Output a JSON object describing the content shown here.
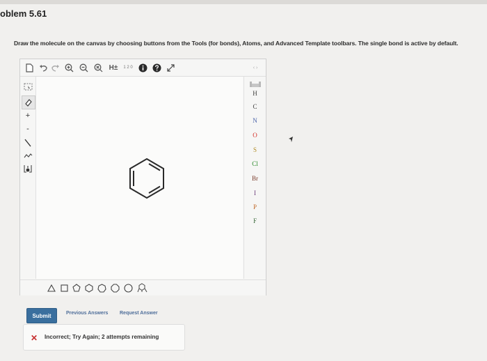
{
  "problem": {
    "title": "oblem 5.61"
  },
  "instructions": "Draw the molecule on the canvas by choosing buttons from the Tools (for bonds), Atoms, and Advanced Template toolbars. The single bond is active by default.",
  "editor": {
    "top_toolbar": {
      "icons": [
        "new-document-icon",
        "undo-icon",
        "redo-icon",
        "zoom-in-icon",
        "zoom-out-icon",
        "zoom-fit-icon",
        "hydrogen-toggle-icon",
        "numbering-icon",
        "info-icon",
        "help-icon",
        "fullscreen-icon"
      ],
      "hydrogen_label": "H±",
      "numbering_label": "1 2 0",
      "expand_label": "‹ ›"
    },
    "left_toolbar": {
      "icons": [
        "select-icon",
        "eraser-icon",
        "charge-plus-icon",
        "charge-minus-icon",
        "single-bond-icon",
        "chain-icon",
        "template-icon"
      ],
      "plus_label": "+",
      "minus_label": "-"
    },
    "atoms": [
      {
        "symbol": "H",
        "color": "#3b3b3b"
      },
      {
        "symbol": "C",
        "color": "#3b3b3b"
      },
      {
        "symbol": "N",
        "color": "#4a62a8"
      },
      {
        "symbol": "O",
        "color": "#d4302a"
      },
      {
        "symbol": "S",
        "color": "#b08a22"
      },
      {
        "symbol": "Cl",
        "color": "#2a8a2a"
      },
      {
        "symbol": "Br",
        "color": "#7a3b2b"
      },
      {
        "symbol": "I",
        "color": "#6b3b7a"
      },
      {
        "symbol": "P",
        "color": "#c06a2a"
      },
      {
        "symbol": "F",
        "color": "#3b6a3b"
      }
    ],
    "bottom_toolbar": {
      "templates": [
        "triangle-ring-icon",
        "square-ring-icon",
        "pentagon-ring-icon",
        "hexagon-ring-icon",
        "heptagon-ring-icon",
        "octagon-ring-icon",
        "benzene-chair-icon"
      ]
    },
    "canvas": {
      "molecule": "benzene-ring"
    }
  },
  "actions": {
    "submit_label": "Submit",
    "previous_answers_label": "Previous Answers",
    "request_answer_label": "Request Answer"
  },
  "feedback": {
    "status": "error",
    "message": "Incorrect; Try Again; 2 attempts remaining",
    "icon": "x-icon",
    "color": "#c62f2f"
  },
  "colors": {
    "accent": "#3a6f9e",
    "link": "#4f6e9a",
    "error": "#c62f2f"
  }
}
